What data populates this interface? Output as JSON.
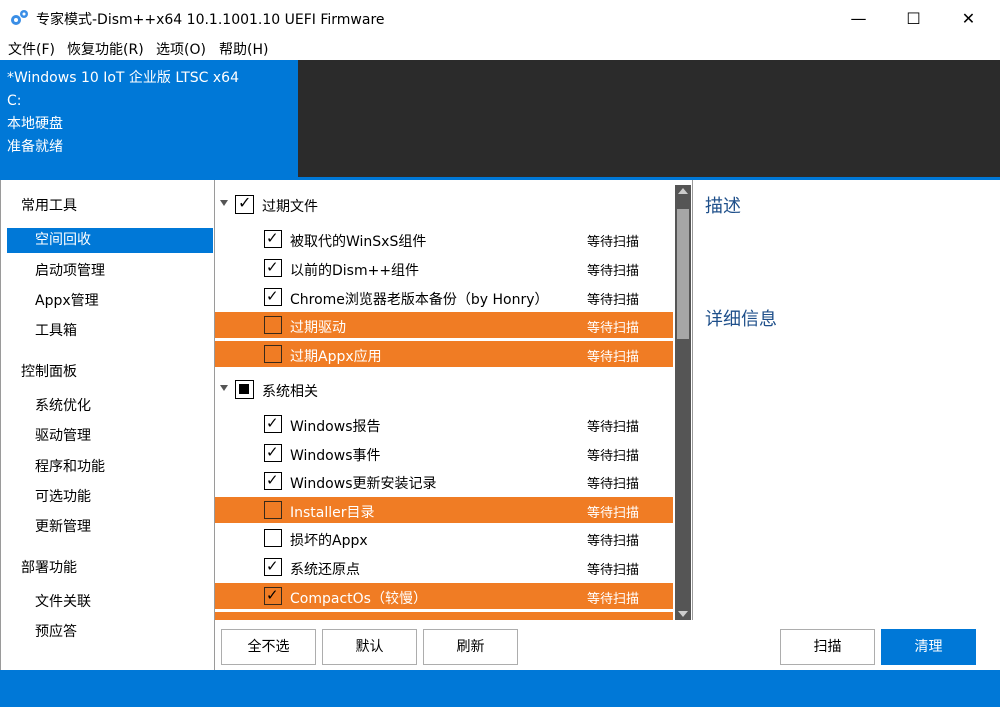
{
  "window": {
    "title": "专家模式-Dism++x64 10.1.1001.10 UEFI Firmware",
    "controls": {
      "minimize": "—",
      "maximize": "☐",
      "close": "✕"
    }
  },
  "menu": [
    "文件(F)",
    "恢复功能(R)",
    "选项(O)",
    "帮助(H)"
  ],
  "header": {
    "os": "*Windows 10 IoT 企业版 LTSC x64",
    "drive": "C:",
    "disk": "本地硬盘",
    "status": "准备就绪"
  },
  "sidebar": {
    "groups": [
      {
        "title": "常用工具",
        "items": [
          "空间回收",
          "启动项管理",
          "Appx管理",
          "工具箱"
        ]
      },
      {
        "title": "控制面板",
        "items": [
          "系统优化",
          "驱动管理",
          "程序和功能",
          "可选功能",
          "更新管理"
        ]
      },
      {
        "title": "部署功能",
        "items": [
          "文件关联",
          "预应答"
        ]
      }
    ],
    "selected": "空间回收"
  },
  "list": {
    "groups": [
      {
        "label": "过期文件",
        "state": "checked",
        "items": [
          {
            "label": "被取代的WinSxS组件",
            "status": "等待扫描",
            "checked": true,
            "highlight": false
          },
          {
            "label": "以前的Dism++组件",
            "status": "等待扫描",
            "checked": true,
            "highlight": false
          },
          {
            "label": "Chrome浏览器老版本备份（by Honry）",
            "status": "等待扫描",
            "checked": true,
            "highlight": false
          },
          {
            "label": "过期驱动",
            "status": "等待扫描",
            "checked": false,
            "highlight": true
          },
          {
            "label": "过期Appx应用",
            "status": "等待扫描",
            "checked": false,
            "highlight": true
          }
        ]
      },
      {
        "label": "系统相关",
        "state": "partial",
        "items": [
          {
            "label": "Windows报告",
            "status": "等待扫描",
            "checked": true,
            "highlight": false
          },
          {
            "label": "Windows事件",
            "status": "等待扫描",
            "checked": true,
            "highlight": false
          },
          {
            "label": "Windows更新安装记录",
            "status": "等待扫描",
            "checked": true,
            "highlight": false
          },
          {
            "label": "Installer目录",
            "status": "等待扫描",
            "checked": false,
            "highlight": true
          },
          {
            "label": "损坏的Appx",
            "status": "等待扫描",
            "checked": false,
            "highlight": false
          },
          {
            "label": "系统还原点",
            "status": "等待扫描",
            "checked": true,
            "highlight": false
          },
          {
            "label": "CompactOs（较慢）",
            "status": "等待扫描",
            "checked": true,
            "highlight": true
          }
        ]
      }
    ]
  },
  "description": {
    "title": "描述",
    "detail_title": "详细信息"
  },
  "buttons": {
    "select_none": "全不选",
    "default": "默认",
    "refresh": "刷新",
    "scan": "扫描",
    "clean": "清理"
  },
  "colors": {
    "accent": "#0078d7",
    "highlight": "#f07c24",
    "header_dark": "#2b2b2b"
  },
  "icons": {
    "app": "gears-icon"
  }
}
